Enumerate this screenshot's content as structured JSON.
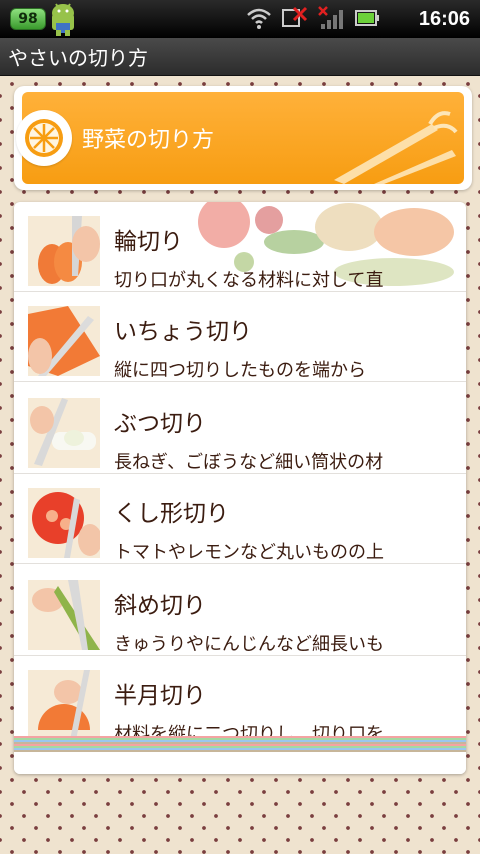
{
  "status_bar": {
    "battery_level": "98",
    "time": "16:06",
    "icons": [
      "android-notification-icon",
      "wifi-icon",
      "no-sync-icon",
      "no-signal-icon",
      "battery-icon"
    ]
  },
  "app": {
    "title": "やさいの切り方"
  },
  "banner": {
    "title": "野菜の切り方",
    "icon": "orange-slice-icon",
    "accent_color": "#f79d12"
  },
  "list": {
    "items": [
      {
        "title": "輪切り",
        "description": "切り口が丸くなる材料に対して直"
      },
      {
        "title": "いちょう切り",
        "description": "縦に四つ切りしたものを端から"
      },
      {
        "title": "ぶつ切り",
        "description": "長ねぎ、ごぼうなど細い筒状の材"
      },
      {
        "title": "くし形切り",
        "description": "トマトやレモンなど丸いものの上"
      },
      {
        "title": "斜め切り",
        "description": "きゅうりやにんじんなど細長いも"
      },
      {
        "title": "半月切り",
        "description": "材料を縦に二つ切りし、切り口を"
      }
    ]
  },
  "colors": {
    "text_brown": "#3b1c10",
    "dot_color": "#7a3f3f",
    "background": "#efe3cf"
  }
}
